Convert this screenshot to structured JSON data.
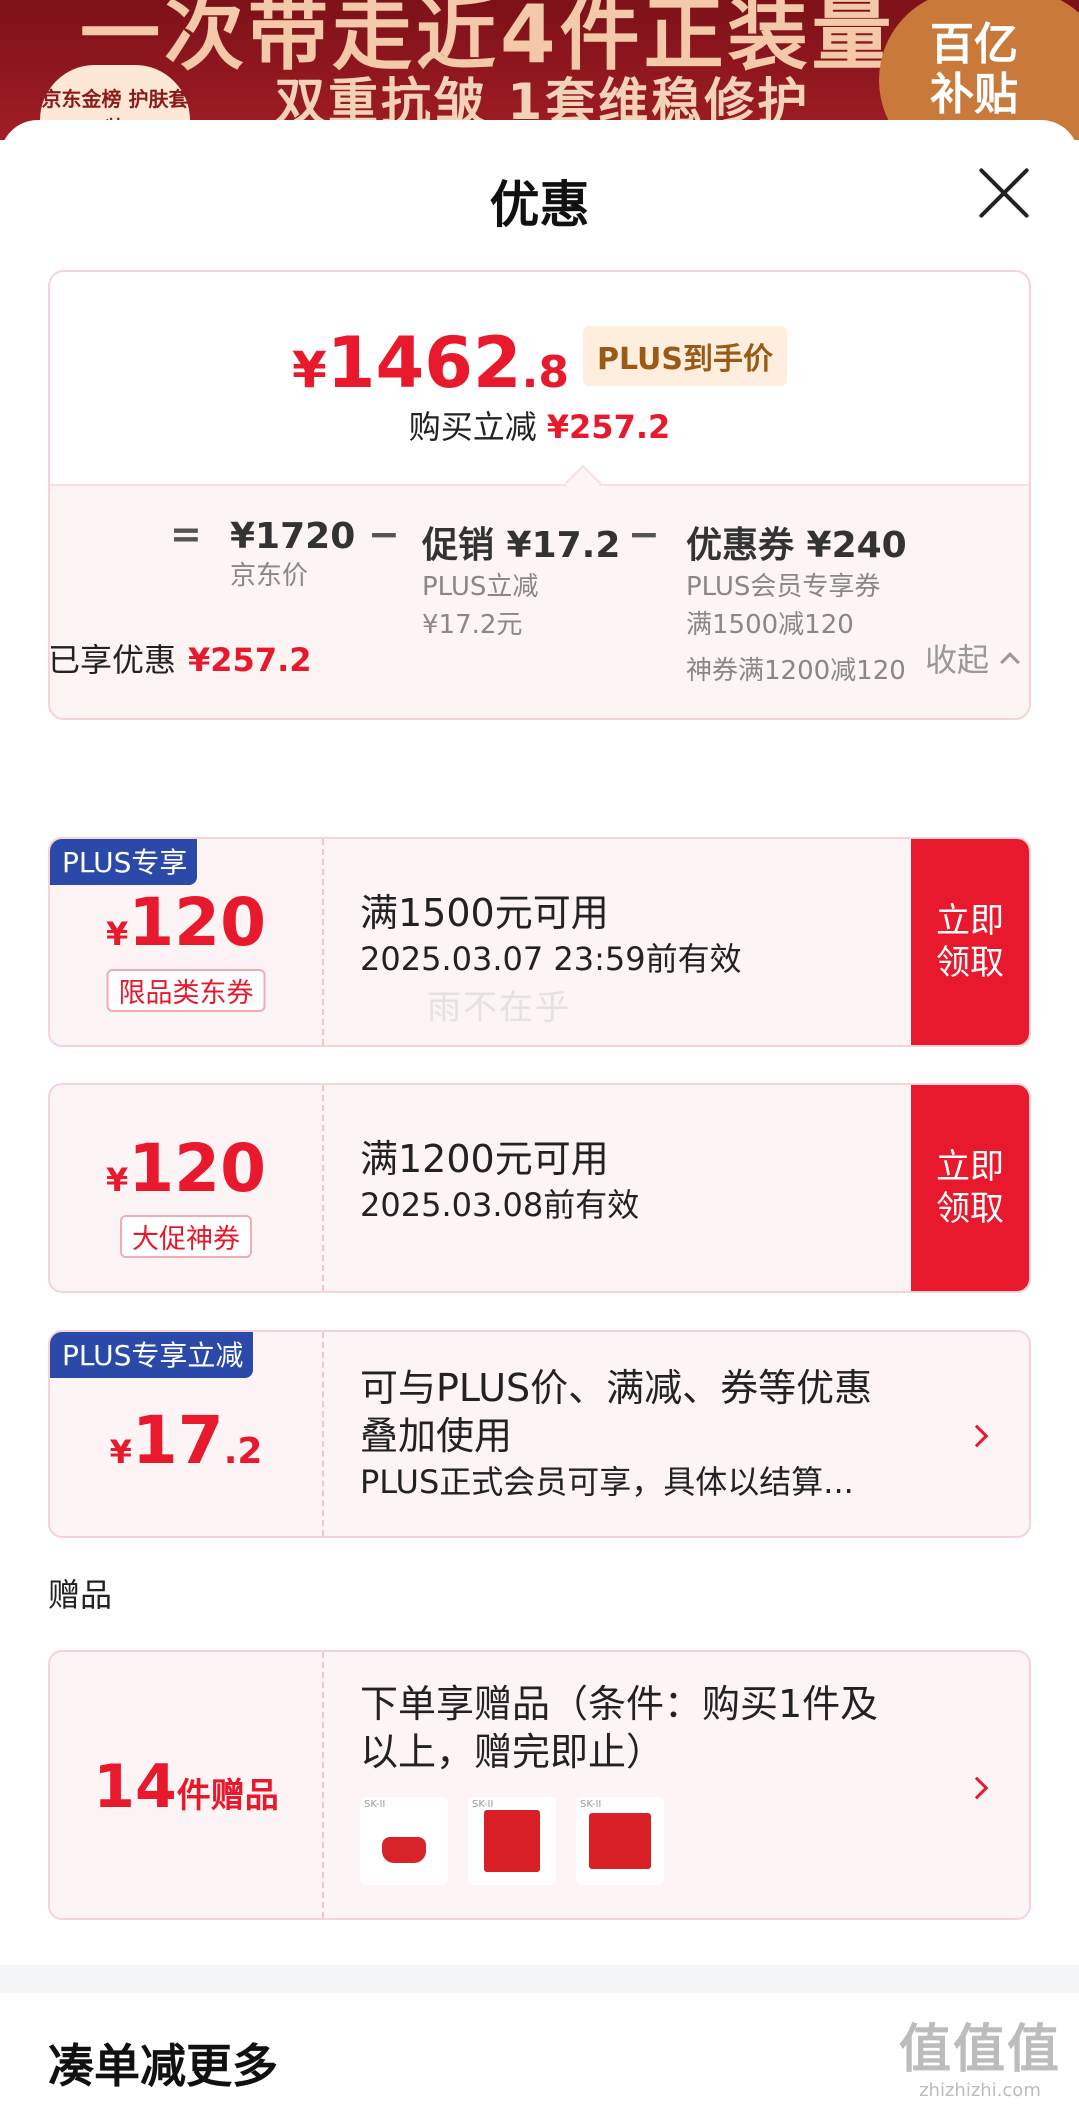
{
  "banner": {
    "line1": "一次带走近4件正装量",
    "line2": "双重抗皱 1套维稳修护",
    "badge": "京东金榜 护肤套装",
    "subsidy_top": "百亿",
    "subsidy_bottom": "补贴"
  },
  "sheet": {
    "title": "优惠"
  },
  "summary": {
    "price_symbol": "¥",
    "price_int": "1462",
    "price_dec": ".8",
    "price_tag": "PLUS到手价",
    "buy_label": "购买立减",
    "buy_amount": "¥257.2",
    "ops": {
      "eq": "=",
      "minus1": "−",
      "minus2": "−"
    },
    "items": [
      {
        "main": "¥1720",
        "sub1": "京东价",
        "sub2": "",
        "sub3": ""
      },
      {
        "main": "促销 ¥17.2",
        "sub1": "PLUS立减",
        "sub2": "¥17.2元",
        "sub3": ""
      },
      {
        "main": "优惠券 ¥240",
        "sub1": "PLUS会员专享券",
        "sub2": "满1500减120",
        "sub3": "神券满1200减120"
      }
    ]
  },
  "saved": {
    "label": "已享优惠",
    "amount": "¥257.2",
    "collapse": "收起"
  },
  "coupons": [
    {
      "tag": "PLUS专享",
      "symbol": "¥",
      "amount": "120",
      "sub_tag": "限品类东券",
      "line1": "满1500元可用",
      "line2": "2025.03.07 23:59前有效",
      "button_l1": "立即",
      "button_l2": "领取"
    },
    {
      "tag": "",
      "symbol": "¥",
      "amount": "120",
      "sub_tag": "大促神券",
      "line1": "满1200元可用",
      "line2": "2025.03.08前有效",
      "button_l1": "立即",
      "button_l2": "领取"
    }
  ],
  "plus_discount": {
    "tag": "PLUS专享立减",
    "symbol": "¥",
    "amount_int": "17",
    "amount_dec": ".2",
    "line1": "可与PLUS价、满减、券等优惠",
    "line2": "叠加使用",
    "line3": "PLUS正式会员可享，具体以结算..."
  },
  "gifts": {
    "section_label": "赠品",
    "count": "14",
    "count_unit": "件赠品",
    "line1": "下单享赠品（条件：购买1件及",
    "line2": "以上，赠完即止）",
    "thumb_brands": [
      "SK-II",
      "SK-II",
      "SK-II"
    ]
  },
  "watermark": "雨不在乎",
  "more": {
    "title": "凑单减更多"
  },
  "site_mark": {
    "big": "值值值",
    "small": "zhizhizhi.com"
  }
}
